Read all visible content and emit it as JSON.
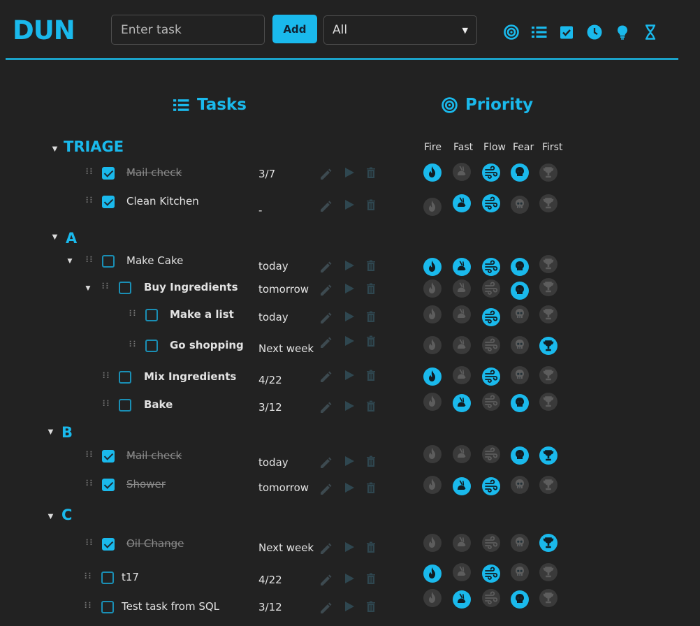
{
  "app": {
    "logo": "DUN"
  },
  "header": {
    "input_placeholder": "Enter task",
    "add_label": "Add",
    "filter_value": "All",
    "nav_icons": [
      "target-icon",
      "list-icon",
      "check-square-icon",
      "clock-icon",
      "lightbulb-icon",
      "hourglass-icon"
    ]
  },
  "sections": {
    "tasks": "Tasks",
    "priority": "Priority"
  },
  "priority_columns": [
    "Fire",
    "Fast",
    "Flow",
    "Fear",
    "First"
  ],
  "colors": {
    "accent": "#1ab9ec",
    "background": "#222222",
    "inactive_circle": "#3a3a3a",
    "divider": "#1ba2c9"
  },
  "groups": [
    {
      "label": "TRIAGE"
    },
    {
      "label": "A"
    },
    {
      "label": "B"
    },
    {
      "label": "C"
    }
  ],
  "rows": [
    {
      "name": "Mail check",
      "due": "3/7",
      "checked": true,
      "done": true,
      "bold": false,
      "prio": [
        true,
        false,
        true,
        true,
        false
      ]
    },
    {
      "name": "Clean Kitchen",
      "due": "-",
      "checked": true,
      "done": false,
      "bold": false,
      "prio": [
        false,
        true,
        true,
        false,
        false
      ]
    },
    {
      "name": "Make Cake",
      "due": "today",
      "checked": false,
      "done": false,
      "bold": false,
      "prio": [
        true,
        true,
        true,
        true,
        false
      ]
    },
    {
      "name": "Buy Ingredients",
      "due": "tomorrow",
      "checked": false,
      "done": false,
      "bold": true,
      "prio": [
        false,
        false,
        false,
        true,
        false
      ]
    },
    {
      "name": "Make a list",
      "due": "today",
      "checked": false,
      "done": false,
      "bold": true,
      "prio": [
        false,
        false,
        true,
        false,
        false
      ]
    },
    {
      "name": "Go shopping",
      "due": "Next week",
      "checked": false,
      "done": false,
      "bold": true,
      "prio": [
        false,
        false,
        false,
        false,
        true
      ]
    },
    {
      "name": "Mix Ingredients",
      "due": "4/22",
      "checked": false,
      "done": false,
      "bold": true,
      "prio": [
        true,
        false,
        true,
        false,
        false
      ]
    },
    {
      "name": "Bake",
      "due": "3/12",
      "checked": false,
      "done": false,
      "bold": true,
      "prio": [
        false,
        true,
        false,
        true,
        false
      ]
    },
    {
      "name": "Mail check",
      "due": "today",
      "checked": true,
      "done": true,
      "bold": false,
      "prio": [
        false,
        false,
        false,
        true,
        true
      ]
    },
    {
      "name": "Shower",
      "due": "tomorrow",
      "checked": true,
      "done": true,
      "bold": false,
      "prio": [
        false,
        true,
        true,
        false,
        false
      ]
    },
    {
      "name": "Oil Change",
      "due": "Next week",
      "checked": true,
      "done": true,
      "bold": false,
      "prio": [
        false,
        false,
        false,
        false,
        true
      ]
    },
    {
      "name": "t17",
      "due": "4/22",
      "checked": false,
      "done": false,
      "bold": false,
      "prio": [
        true,
        false,
        true,
        false,
        false
      ]
    },
    {
      "name": "Test task from SQL",
      "due": "3/12",
      "checked": false,
      "done": false,
      "bold": false,
      "prio": [
        false,
        true,
        false,
        true,
        false
      ]
    }
  ]
}
